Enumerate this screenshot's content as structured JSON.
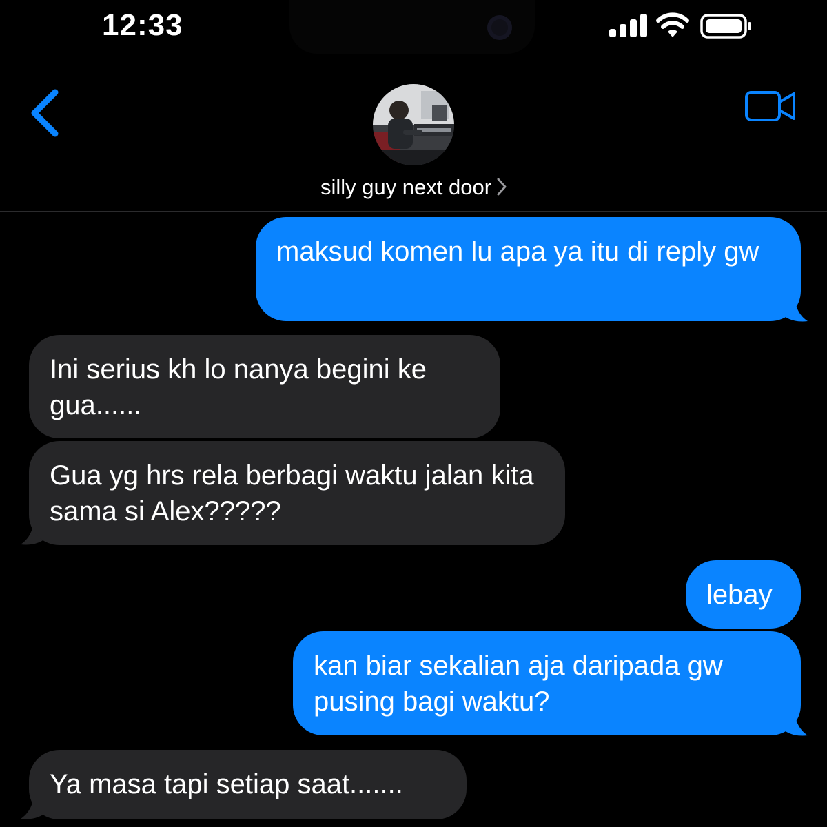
{
  "status_bar": {
    "time": "12:33",
    "icons": [
      "signal-icon",
      "wifi-icon",
      "battery-icon"
    ]
  },
  "header": {
    "contact_name": "silly guy next door",
    "back_icon": "chevron-left-icon",
    "video_icon": "video-camera-icon",
    "avatar": "contact-avatar-photo"
  },
  "messages": [
    {
      "direction": "sent",
      "text": "maksud komen lu apa ya itu di reply gw"
    },
    {
      "direction": "received",
      "text": "Ini serius kh lo nanya begini ke gua......"
    },
    {
      "direction": "received",
      "text": "Gua yg hrs rela berbagi waktu jalan kita sama si Alex?????"
    },
    {
      "direction": "sent",
      "text": "lebay"
    },
    {
      "direction": "sent",
      "text": "kan biar sekalian aja daripada gw pusing bagi waktu?"
    },
    {
      "direction": "received",
      "text": "Ya masa tapi setiap saat......."
    }
  ],
  "colors": {
    "sent_bubble": "#0a84ff",
    "received_bubble": "#262628",
    "accent": "#0a84ff",
    "background": "#000000"
  }
}
